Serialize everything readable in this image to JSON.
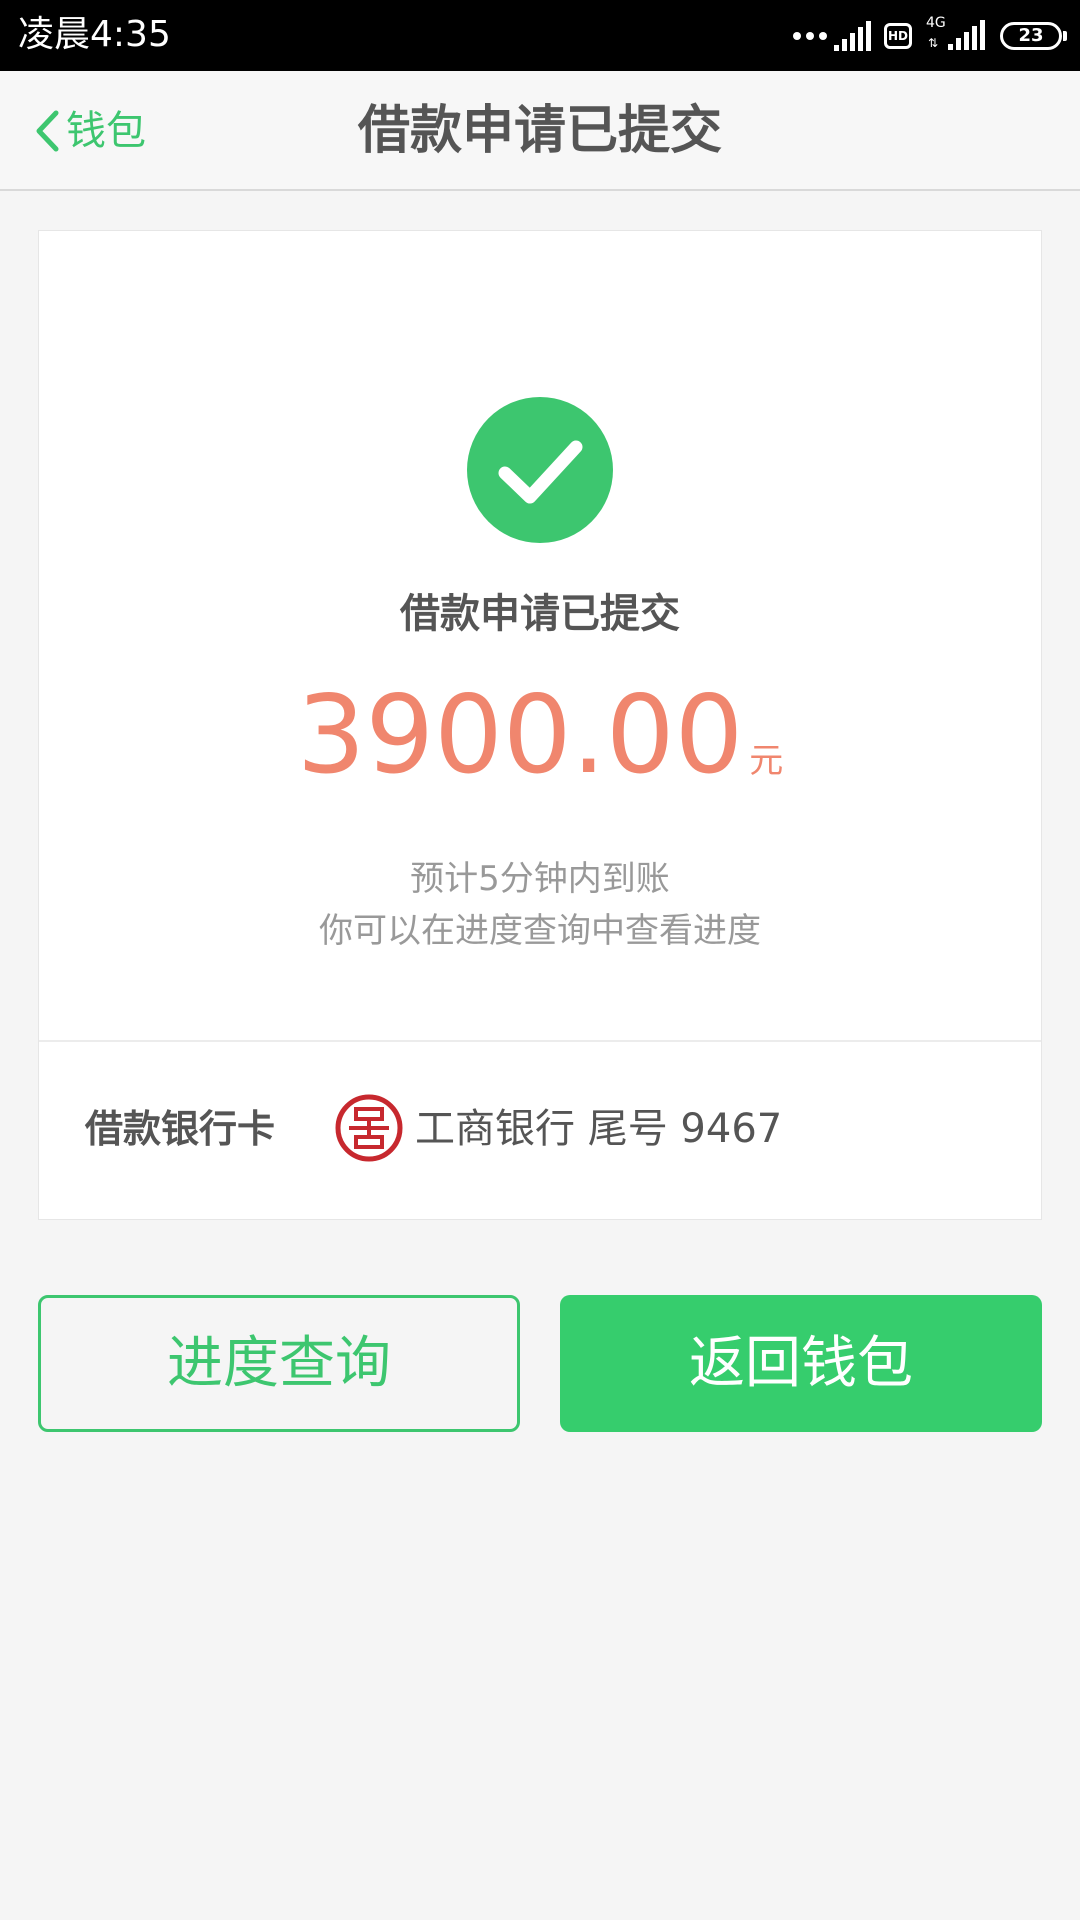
{
  "status_bar": {
    "time": "凌晨4:35",
    "hd_label": "HD",
    "network_label": "4G",
    "network_arrows": "⇅",
    "battery_level": "23"
  },
  "nav": {
    "back_label": "钱包",
    "title": "借款申请已提交"
  },
  "result": {
    "icon": "check-circle-icon",
    "title": "借款申请已提交",
    "amount": "3900.00",
    "unit": "元",
    "eta": "预计5分钟内到账",
    "hint": "你可以在进度查询中查看进度"
  },
  "bank": {
    "label": "借款银行卡",
    "logo": "icbc-logo",
    "name": "工商银行 尾号 9467"
  },
  "buttons": {
    "progress": "进度查询",
    "back_to_wallet": "返回钱包"
  },
  "colors": {
    "accent_green": "#3dc66f",
    "button_green": "#36cd6d",
    "amount_orange": "#f0866e",
    "bank_red": "#c7282e"
  }
}
